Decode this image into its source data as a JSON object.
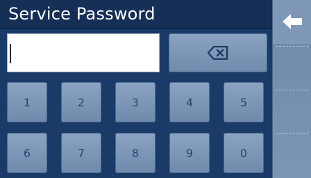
{
  "title": "Service Password",
  "password_field": {
    "value": ""
  },
  "side_nav": {
    "back_icon": "arrow-left-icon"
  },
  "backspace_icon": "backspace-icon",
  "keypad": {
    "row1": [
      "1",
      "2",
      "3",
      "4",
      "5"
    ],
    "row2": [
      "6",
      "7",
      "8",
      "9",
      "0"
    ]
  },
  "colors": {
    "background": "#1a3a68",
    "title_bar": "#152f57",
    "key_gradient_top": "#8aa3c2",
    "key_gradient_bottom": "#6f8aac",
    "key_text": "#26456f",
    "side_panel": "#7b95b4"
  }
}
